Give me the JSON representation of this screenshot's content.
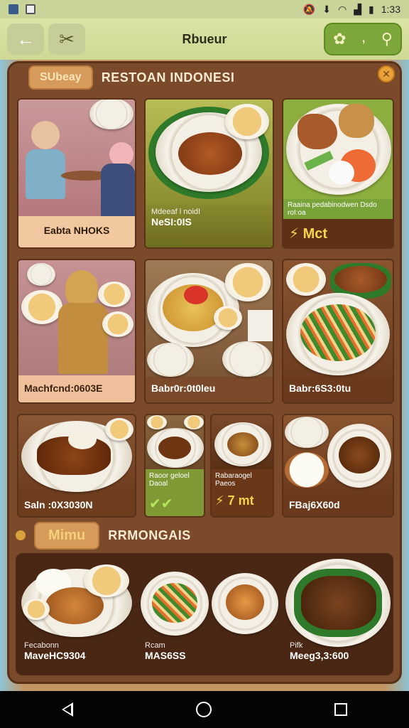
{
  "status_bar": {
    "time": "1:33"
  },
  "app_bar": {
    "title": "Rbueur"
  },
  "section1": {
    "pill": "SUbeay",
    "title": "RESTOAN INDONESI"
  },
  "grid": [
    {
      "caption": "Eabta NHOKS",
      "sub": ""
    },
    {
      "caption": "NeSI:0IS",
      "sub": "Mdeeaf l noidI"
    },
    {
      "caption": "Mct",
      "sub": "Raaina pedabinodwen Dsdo roI:oa"
    },
    {
      "caption": "Machfcnd:0603E",
      "sub": ""
    },
    {
      "caption": "Babr0r:0t0leu",
      "sub": ""
    },
    {
      "caption": "Babr:6S3:0tu",
      "sub": ""
    },
    {
      "caption": "Saln :0X3030N",
      "sub": ""
    },
    {
      "caption": "",
      "sub": "Raoor geloel Daoal"
    },
    {
      "caption": "7 mt",
      "sub": "Rabaraogel Paeos"
    },
    {
      "caption": "FBaj6X60d",
      "sub": ""
    }
  ],
  "section2": {
    "pill": "Mimu",
    "title": "RRMONGAIS"
  },
  "bottom_cards": [
    {
      "caption": "MaveHC9304",
      "sub": "Fecabonn"
    },
    {
      "caption": "MAS6SS",
      "sub": "Rcam"
    },
    {
      "caption": "Meeg3,3:600",
      "sub": "Pifk"
    }
  ]
}
